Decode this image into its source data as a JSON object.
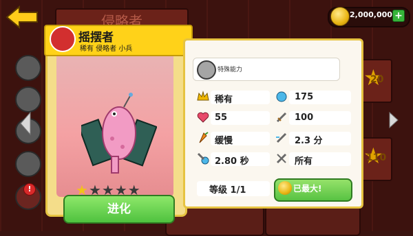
{
  "header": {
    "title": "侵略者"
  },
  "coins": {
    "amount": "2,000,000",
    "add_label": "+"
  },
  "side_badge": "!",
  "right_slots": [
    {
      "num": "20"
    },
    {
      "num": "110"
    }
  ],
  "unit": {
    "name": "摇摆者",
    "tags": "稀有  侵略者  小兵",
    "ability_label": "特殊能力",
    "stats": [
      {
        "icon": "crown-icon",
        "value": "稀有"
      },
      {
        "icon": "orb-icon",
        "value": "175"
      },
      {
        "icon": "heart-icon",
        "value": "55"
      },
      {
        "icon": "sword-icon",
        "value": "100"
      },
      {
        "icon": "carrot-icon",
        "value": "缓慢"
      },
      {
        "icon": "sword-speed-icon",
        "value": "2.3 分"
      },
      {
        "icon": "attack-time-icon",
        "value": "2.80 秒"
      },
      {
        "icon": "target-sword-icon",
        "value": "所有"
      }
    ],
    "stars_filled": 1,
    "stars_total": 5,
    "level": {
      "label": "等级",
      "value": "1/1"
    }
  },
  "buttons": {
    "evolve": "进化",
    "maxed": "已最大!"
  }
}
